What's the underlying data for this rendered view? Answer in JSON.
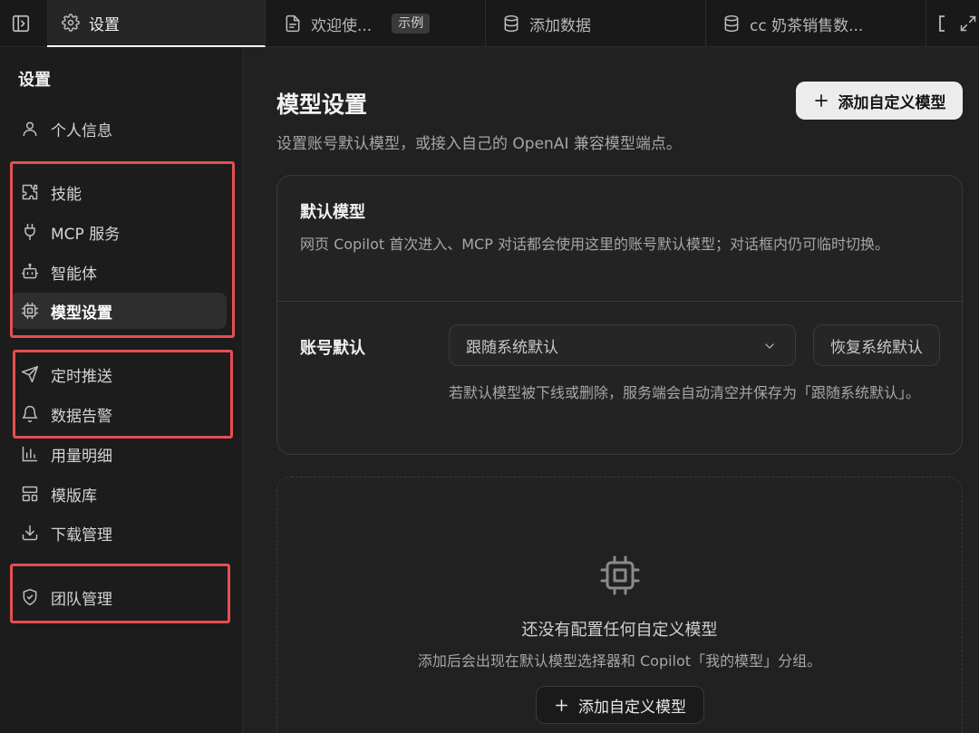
{
  "tabs": [
    {
      "label": "设置",
      "icon": "gear-icon"
    },
    {
      "label": "欢迎使...",
      "icon": "document-icon",
      "badge": "示例"
    },
    {
      "label": "添加数据",
      "icon": "database-icon"
    },
    {
      "label": "cc 奶茶销售数...",
      "icon": "database-icon"
    }
  ],
  "sidebar": {
    "title": "设置",
    "items": [
      {
        "label": "个人信息",
        "icon": "user-icon"
      },
      {
        "label": "技能",
        "icon": "puzzle-icon"
      },
      {
        "label": "MCP 服务",
        "icon": "plug-icon"
      },
      {
        "label": "智能体",
        "icon": "robot-icon"
      },
      {
        "label": "模型设置",
        "icon": "chip-icon",
        "active": true
      },
      {
        "label": "定时推送",
        "icon": "send-icon"
      },
      {
        "label": "数据告警",
        "icon": "bell-icon"
      },
      {
        "label": "用量明细",
        "icon": "bar-chart-icon"
      },
      {
        "label": "模版库",
        "icon": "template-icon"
      },
      {
        "label": "下载管理",
        "icon": "download-icon"
      },
      {
        "label": "团队管理",
        "icon": "shield-icon"
      }
    ]
  },
  "main": {
    "title": "模型设置",
    "subtitle": "设置账号默认模型，或接入自己的 OpenAI 兼容模型端点。",
    "add_button": "添加自定义模型",
    "default_card": {
      "title": "默认模型",
      "description": "网页 Copilot 首次进入、MCP 对话都会使用这里的账号默认模型；对话框内仍可临时切换。",
      "field_label": "账号默认",
      "select_value": "跟随系统默认",
      "reset_button": "恢复系统默认",
      "hint": "若默认模型被下线或删除，服务端会自动清空并保存为「跟随系统默认」。"
    },
    "empty_state": {
      "title": "还没有配置任何自定义模型",
      "subtitle": "添加后会出现在默认模型选择器和 Copilot「我的模型」分组。",
      "button": "添加自定义模型"
    }
  },
  "colors": {
    "highlight": "#e54f52",
    "background": "#212121",
    "sidebar": "#1c1c1c",
    "primary_button": "#ececec"
  }
}
